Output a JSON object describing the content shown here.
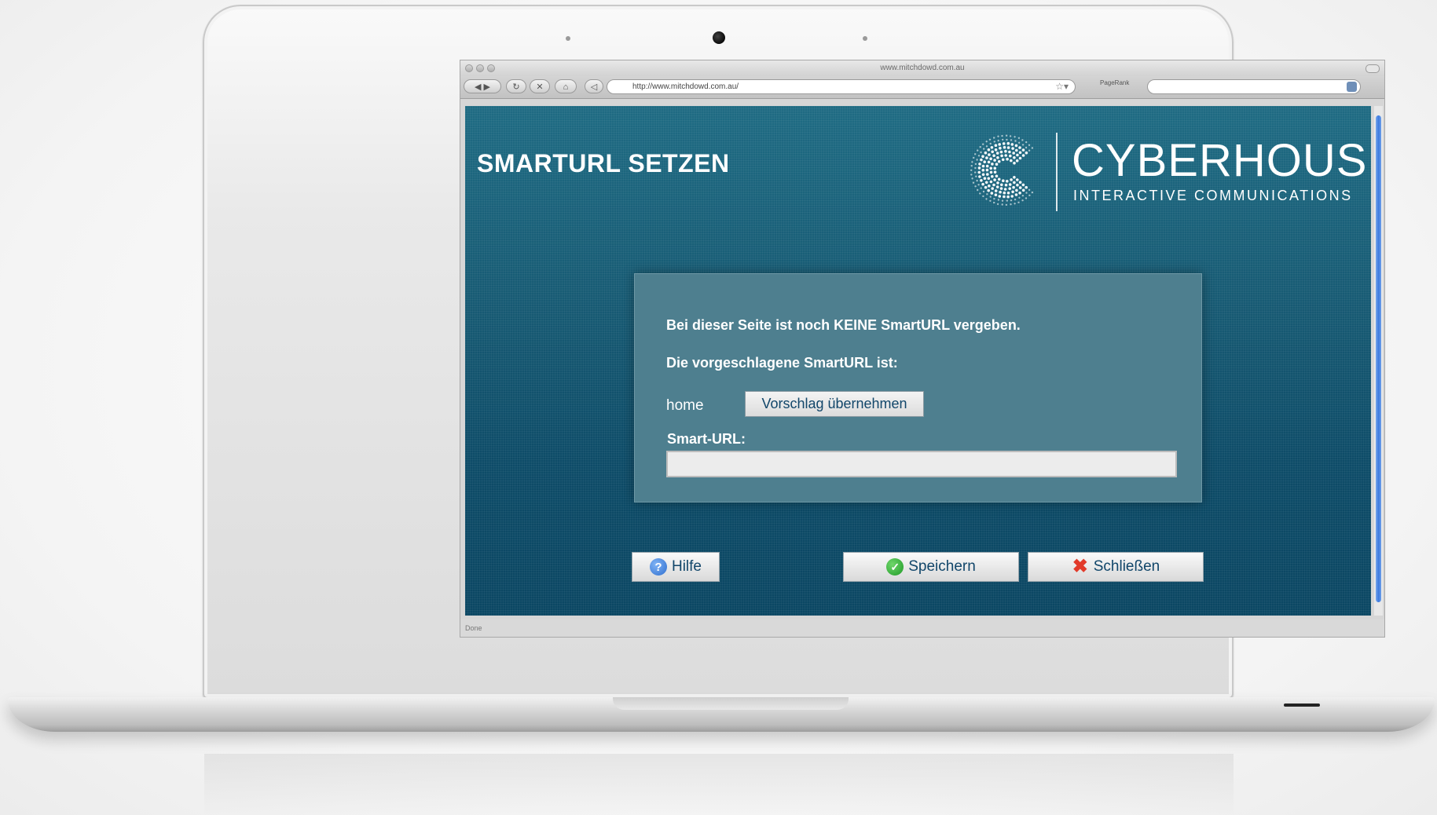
{
  "browser": {
    "window_title": "www.mitchdowd.com.au",
    "url": "http://www.mitchdowd.com.au/",
    "pagerank_label": "PageRank",
    "status": "Done"
  },
  "page": {
    "title": "SMARTURL SETZEN",
    "logo": {
      "name": "CYBERHOUSE",
      "tagline": "INTERACTIVE COMMUNICATIONS"
    }
  },
  "dialog": {
    "message_1": "Bei dieser Seite ist noch KEINE SmartURL vergeben.",
    "message_2": "Die vorgeschlagene SmartURL ist:",
    "suggested_value": "home",
    "suggest_button": "Vorschlag übernehmen",
    "smart_url_label": "Smart-URL:",
    "smart_url_value": ""
  },
  "actions": {
    "help": "Hilfe",
    "save": "Speichern",
    "close": "Schließen"
  },
  "icons": {
    "help": "question-circle-icon",
    "save": "green-check-icon",
    "close": "red-x-icon"
  },
  "colors": {
    "page_background": "#175a73",
    "dialog_background": "#4e7f8f",
    "button_text": "#11466a"
  }
}
